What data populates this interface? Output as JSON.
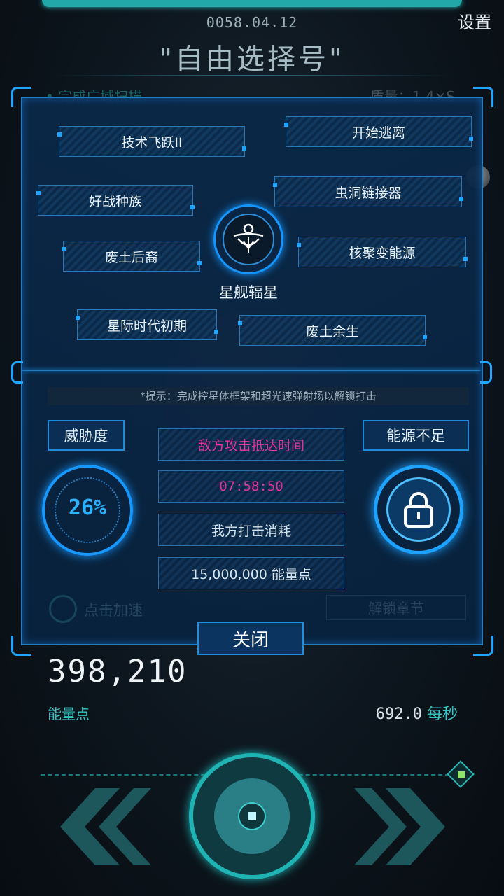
{
  "header": {
    "date": "0058.04.12",
    "settings_label": "设置",
    "title": "\"自由选择号\"",
    "bg_left_text": "• 完成广域扫描",
    "bg_right_text": "质量：1.4×S"
  },
  "tech_tree": {
    "items": [
      "技术飞跃II",
      "开始逃离",
      "好战种族",
      "虫洞链接器",
      "废土后裔",
      "核聚变能源",
      "星际时代初期",
      "废土余生"
    ],
    "center_label": "星舰辐星"
  },
  "status": {
    "hint": "*提示：完成控星体框架和超光速弹射场以解锁打击",
    "threat_label": "威胁度",
    "threat_value": "26%",
    "threat_fraction": 0.26,
    "energy_warning": "能源不足",
    "enemy_arrival_label": "敌方攻击抵达时间",
    "enemy_arrival_time": "07:58:50",
    "our_cost_label": "我方打击消耗",
    "our_cost_value": "15,000,000 能量点",
    "bg_speed_text": "点击加速",
    "bg_unlock_text": "解锁章节"
  },
  "close_label": "关闭",
  "footer": {
    "energy_total": "398,210",
    "energy_label": "能量点",
    "rate_value": "692.0",
    "rate_unit": "每秒"
  },
  "colors": {
    "accent_blue": "#1fa4ff",
    "teal": "#35c3c3",
    "magenta": "#e0359a"
  }
}
